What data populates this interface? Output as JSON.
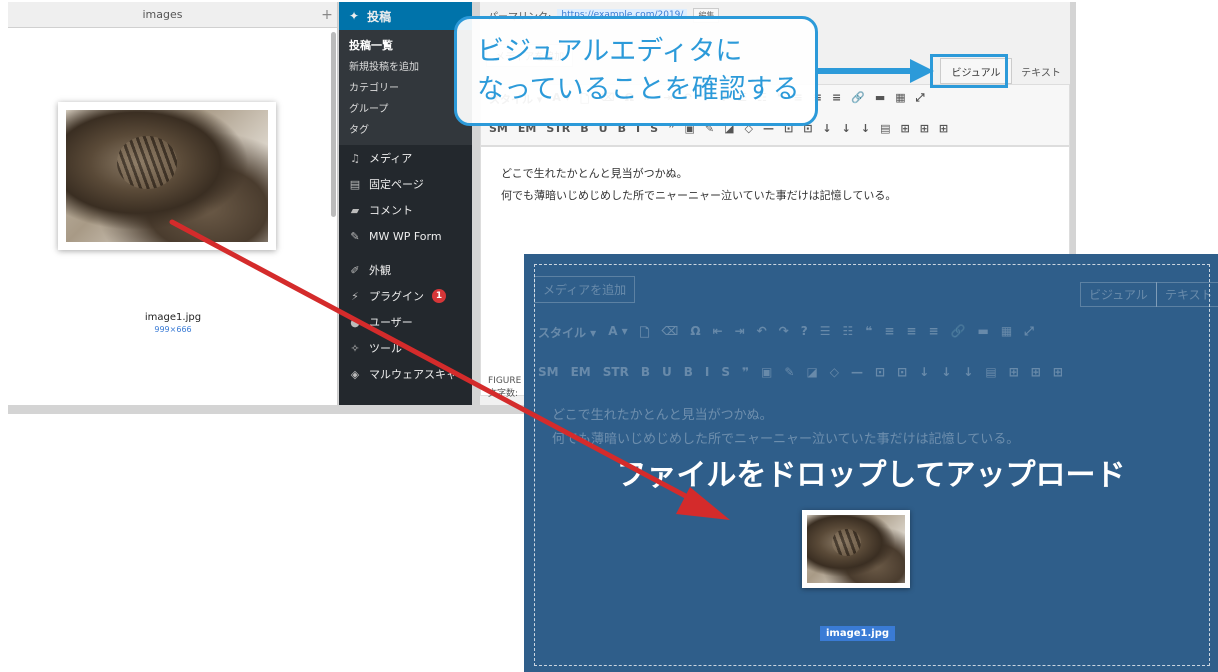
{
  "finder": {
    "tab_title": "images",
    "plus": "+",
    "filename": "image1.jpg",
    "dimensions": "999×666"
  },
  "sidebar": {
    "top_item": "投稿",
    "subitems": [
      "投稿一覧",
      "新規投稿を追加",
      "カテゴリー",
      "グループ",
      "タグ"
    ],
    "menu": [
      {
        "label": "メディア",
        "icon": "media-icon"
      },
      {
        "label": "固定ページ",
        "icon": "page-icon"
      },
      {
        "label": "コメント",
        "icon": "comment-icon"
      },
      {
        "label": "MW WP Form",
        "icon": "pin-icon"
      },
      {
        "label": "外観",
        "icon": "brush-icon"
      },
      {
        "label": "プラグイン",
        "icon": "plugin-icon",
        "badge": "1"
      },
      {
        "label": "ユーザー",
        "icon": "user-icon"
      },
      {
        "label": "ツール",
        "icon": "wrench-icon"
      },
      {
        "label": "マルウェアスキャ",
        "icon": "shield-icon"
      }
    ]
  },
  "editor": {
    "permalink_label": "パーマリンク:",
    "permalink_url": "https://example.com/2019/",
    "permalink_edit": "編集",
    "media_button": "メディアを追加",
    "tab_visual": "ビジュアル",
    "tab_text": "テキスト",
    "toolbar_row1": [
      "スタイル ▾",
      "A ▾",
      "🗋",
      "⌫",
      "Ω",
      "⇤",
      "⇥",
      "↶",
      "↷",
      "?",
      "☰",
      "☷",
      "❝",
      "≡",
      "≡",
      "≡",
      "🔗",
      "▬",
      "▦",
      "⤢"
    ],
    "toolbar_row2": [
      "SM",
      "EM",
      "STR",
      "B",
      "U",
      "B",
      "I",
      "S",
      "❞",
      "▣",
      "✎",
      "◪",
      "◇",
      "—",
      "⊡",
      "⊡",
      "↓",
      "↓",
      "↓",
      "▤",
      "⊞",
      "⊞",
      "⊞"
    ],
    "line1": "どこで生れたかとんと見当がつかぬ。",
    "line2": "何でも薄暗いじめじめした所でニャーニャー泣いていた事だけは記憶している。",
    "figure_label": "FIGURE",
    "word_count_label": "文字数:"
  },
  "callout": {
    "line1": "ビジュアルエディタに",
    "line2": "なっていることを確認する",
    "color": "#2c9ad9"
  },
  "dropzone": {
    "message": "ファイルをドロップしてアップロード",
    "filename": "image1.jpg",
    "background": "#2f5e8a"
  },
  "arrow_color": "#d42b2b"
}
